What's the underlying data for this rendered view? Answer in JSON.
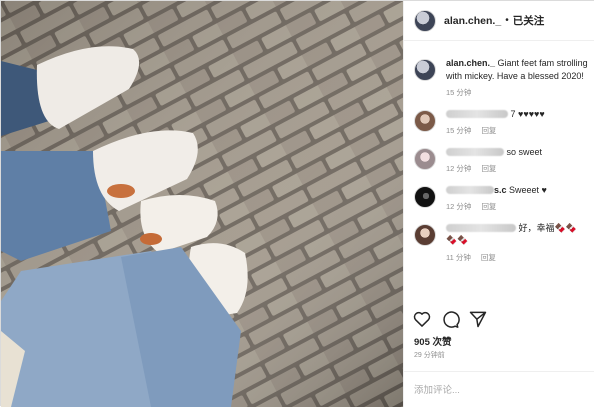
{
  "post": {
    "username": "alan.chen._",
    "separator": "•",
    "follow_status": "已关注"
  },
  "caption": {
    "username": "alan.chen._",
    "text": "Giant feet fam strolling with mickey. Have a blessed 2020!",
    "time": "15 分钟"
  },
  "comments": [
    {
      "name_visible": "",
      "text": "7 ♥♥♥♥♥",
      "time": "15 分钟",
      "reply": "回复"
    },
    {
      "name_visible": "",
      "text": "so sweet",
      "time": "12 分钟",
      "reply": "回复"
    },
    {
      "name_visible": "s.c",
      "text": "Sweeet ♥",
      "time": "12 分钟",
      "reply": "回复"
    },
    {
      "name_visible": "",
      "text": "好，幸福🍫🍫🍫🍫",
      "time": "11 分钟",
      "reply": "回复"
    }
  ],
  "stats": {
    "likes": "905 次赞",
    "ago": "29 分钟前"
  },
  "add_comment": {
    "placeholder": "添加评论..."
  },
  "icons": [
    "heart-icon",
    "comment-icon",
    "share-icon"
  ]
}
